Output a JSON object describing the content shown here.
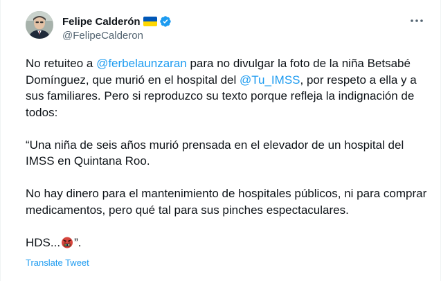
{
  "author": {
    "display_name": "Felipe Calderón",
    "handle": "@FelipeCalderon",
    "verified": true,
    "flag_icon": "ukraine-flag-icon",
    "colors": {
      "verified": "#1d9bf0",
      "flag_blue": "#0057b7",
      "flag_yellow": "#ffd700"
    }
  },
  "menu": {
    "icon": "more-horizontal-icon"
  },
  "tweet": {
    "p1_a": "No retuiteo a ",
    "mention_1": "@ferbelaunzaran",
    "p1_b": " para no divulgar la foto de la niña Betsabé Domínguez, que murió en el hospital del ",
    "mention_2": "@Tu_IMSS",
    "p1_c": ", por respeto a ella y a sus familiares. Pero si reproduzco su texto porque refleja la indignación de todos:",
    "p2": "“Una niña de seis años murió prensada en el elevador de un hospital del IMSS en Quintana Roo.",
    "p3": "No hay dinero para el mantenimiento de hospitales públicos, ni para comprar medicamentos, pero qué tal para sus pinches espectaculares.",
    "p4_a": "HDS...",
    "emoji": "face-with-symbols-on-mouth-icon",
    "p4_b": "”."
  },
  "translate_label": "Translate Tweet",
  "colors": {
    "link": "#1d9bf0",
    "text": "#0f1419",
    "secondary": "#536471"
  }
}
